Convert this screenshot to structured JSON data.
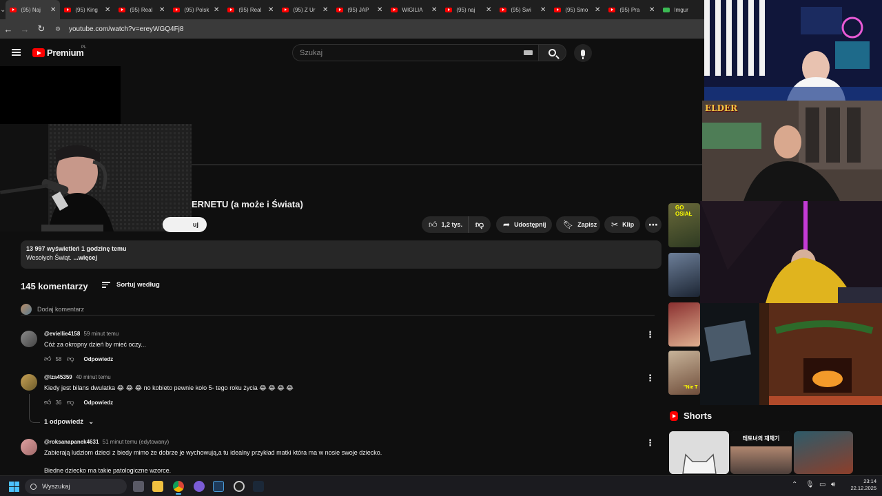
{
  "browser": {
    "tabs": [
      {
        "label": "(95) Naj"
      },
      {
        "label": "(95) King"
      },
      {
        "label": "(95) Real"
      },
      {
        "label": "(95) Polsk"
      },
      {
        "label": "(95) Real"
      },
      {
        "label": "(95) Z Ur"
      },
      {
        "label": "(95) JAP"
      },
      {
        "label": "WIGILIA"
      },
      {
        "label": "(95) naj"
      },
      {
        "label": "(95) Świ"
      },
      {
        "label": "(95) Smo"
      },
      {
        "label": "(95) Pra"
      },
      {
        "label": "Imgur"
      }
    ],
    "url": "youtube.com/watch?v=ereyWGQ4Fj8"
  },
  "yt": {
    "logo_text": "Premium",
    "country": "PL",
    "search_placeholder": "Szukaj"
  },
  "video": {
    "title": "ERNETU (a może i Świata)",
    "subscribe_label": "uj",
    "likes": "1,2 tys.",
    "share": "Udostępnij",
    "save": "Zapisz",
    "clip": "Klip",
    "views_time": "13 997 wyświetleń  1 godzinę temu",
    "description": "Wesołych Świąt.",
    "more": "...więcej"
  },
  "comments": {
    "count": "145 komentarzy",
    "sort": "Sortuj według",
    "add_placeholder": "Dodaj komentarz",
    "reply_label": "Odpowiedz",
    "items": [
      {
        "author": "@eviellie4158",
        "time": "59 minut temu",
        "text": "Cóż za okropny dzień by mieć oczy...",
        "likes": "58"
      },
      {
        "author": "@lza45359",
        "time": "40 minut temu",
        "text": "Kiedy jest bilans dwulatka 😂 😂 😂  no kobieto pewnie koło 5- tego roku życia 😂 😂 😂 😂",
        "likes": "36"
      },
      {
        "author": "@roksanapanek4631",
        "time": "51 minut temu (edytowany)",
        "text": "Zabierają ludziom dzieci z biedy mimo że dobrze je wychowują,a tu idealny przykład matki która ma w nosie swoje dziecko.\n\nBiedne dziecko ma takie patologiczne wzorce."
      }
    ],
    "replies_toggle": "1 odpowiedź"
  },
  "sidebar": {
    "shorts_title": "Shorts",
    "short_card_text": "테토녀의 재채기",
    "thumb_texts": [
      "GO OSIAŁ",
      "\"Nie T"
    ]
  },
  "overlay": {
    "cam_label": "ELDER"
  },
  "taskbar": {
    "search": "Wyszukaj",
    "time": "23:14",
    "date": "22.12.2025"
  }
}
